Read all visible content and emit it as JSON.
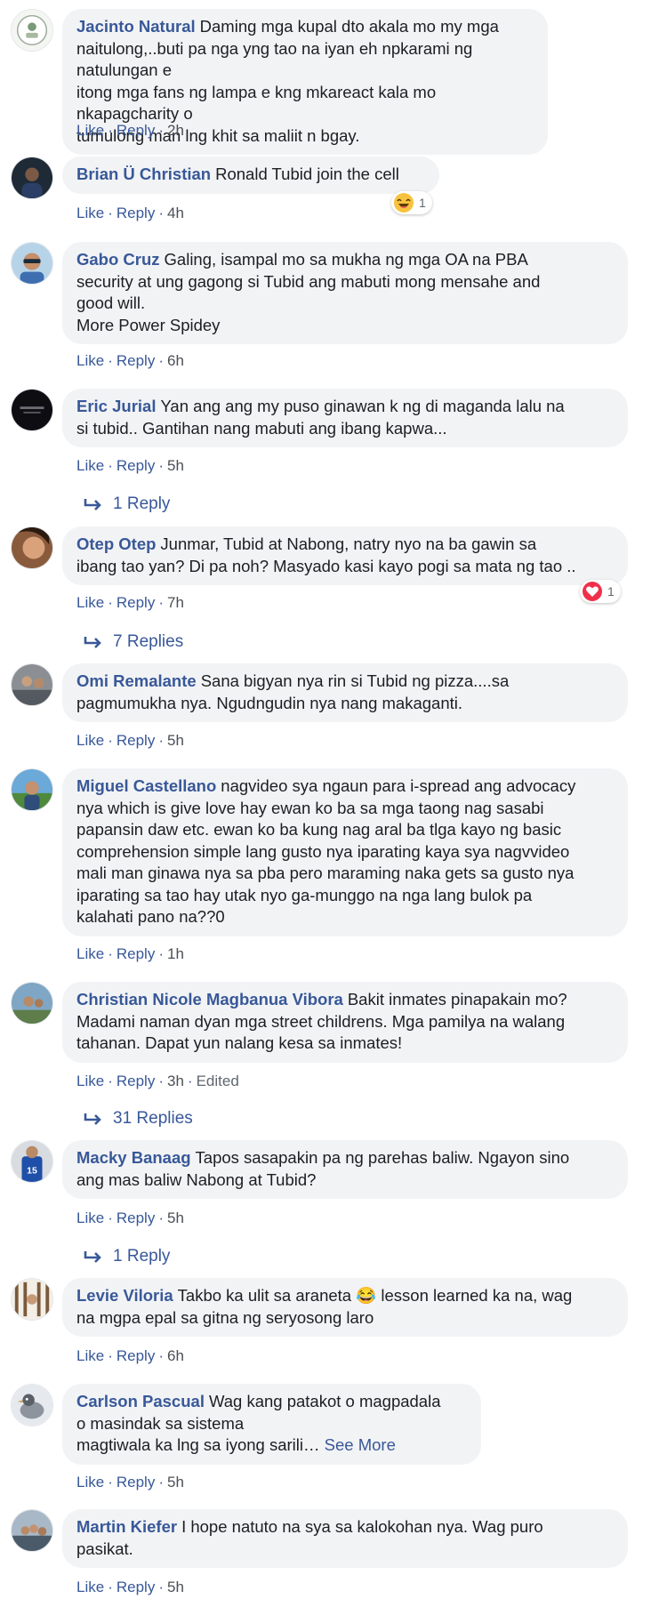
{
  "ui": {
    "like": "Like",
    "reply": "Reply",
    "dot": "·",
    "see_more": "See More",
    "edited": "Edited"
  },
  "comments": [
    {
      "author": "Jacinto Natural",
      "lines": [
        "Daming mga kupal dto akala mo my mga",
        "naitulong,..buti pa nga yng tao na iyan eh npkarami ng natulungan e",
        "itong mga fans ng lampa e kng mkareact kala mo nkapagcharity o",
        "tumulong man lng khit sa maliit n bgay."
      ],
      "time": "2h"
    },
    {
      "author": "Brian Ü Christian",
      "lines": [
        "Ronald Tubid join the cell"
      ],
      "time": "4h",
      "reaction": {
        "icon": "haha-emoji-icon",
        "count": "1"
      }
    },
    {
      "author": "Gabo Cruz",
      "lines": [
        "Galing, isampal mo sa mukha ng mga OA na PBA",
        "security at ung gagong si Tubid ang mabuti mong mensahe and",
        "good will.",
        "More Power Spidey"
      ],
      "time": "6h"
    },
    {
      "author": "Eric Jurial",
      "lines": [
        "Yan ang ang my puso ginawan k ng di maganda lalu na",
        "si tubid.. Gantihan nang mabuti ang ibang kapwa..."
      ],
      "time": "5h",
      "replies": "1 Reply"
    },
    {
      "author": "Otep Otep",
      "lines": [
        "Junmar, Tubid at Nabong, natry nyo na ba gawin sa",
        "ibang tao yan? Di pa noh? Masyado kasi kayo pogi sa mata ng tao .."
      ],
      "time": "7h",
      "replies": "7 Replies",
      "reaction": {
        "icon": "love-heart-icon",
        "count": "1"
      }
    },
    {
      "author": "Omi Remalante",
      "lines": [
        "Sana bigyan nya rin si Tubid ng pizza....sa",
        "pagmumukha nya. Ngudngudin nya nang makaganti."
      ],
      "time": "5h"
    },
    {
      "author": "Miguel Castellano",
      "lines": [
        "nagvideo sya ngaun para i-spread ang advocacy",
        "nya which is give love hay ewan ko ba sa mga taong nag sasabi",
        "papansin daw etc. ewan ko ba kung nag aral ba tlga kayo ng basic",
        "comprehension simple lang gusto nya iparating kaya sya nagvvideo",
        "mali man ginawa nya sa pba pero maraming naka gets sa gusto nya",
        "iparating sa tao hay utak nyo ga-munggo na nga lang bulok pa",
        "kalahati pano na??0"
      ],
      "time": "1h"
    },
    {
      "author": "Christian Nicole Magbanua Vibora",
      "lines": [
        "Bakit inmates pinapakain mo?",
        "Madami naman dyan mga street childrens. Mga pamilya na walang",
        "tahanan. Dapat yun nalang kesa sa inmates!"
      ],
      "time": "3h",
      "edited": true,
      "replies": "31 Replies"
    },
    {
      "author": "Macky Banaag",
      "lines": [
        "Tapos sasapakin pa ng parehas baliw. Ngayon sino",
        "ang mas baliw Nabong at Tubid?"
      ],
      "time": "5h",
      "replies": "1 Reply"
    },
    {
      "author": "Levie Viloria",
      "lines": [
        "Takbo ka ulit sa araneta 😂 lesson learned ka na, wag",
        "na mgpa epal sa gitna ng seryosong laro"
      ],
      "time": "6h"
    },
    {
      "author": "Carlson Pascual",
      "lines": [
        "Wag kang patakot o magpadala",
        "o masindak sa sistema",
        "magtiwala ka lng sa iyong sarili…"
      ],
      "time": "5h",
      "see_more": true
    },
    {
      "author": "Martin Kiefer",
      "lines": [
        "I hope natuto na sya sa kalokohan nya. Wag puro",
        "pasikat."
      ],
      "time": "5h"
    }
  ]
}
